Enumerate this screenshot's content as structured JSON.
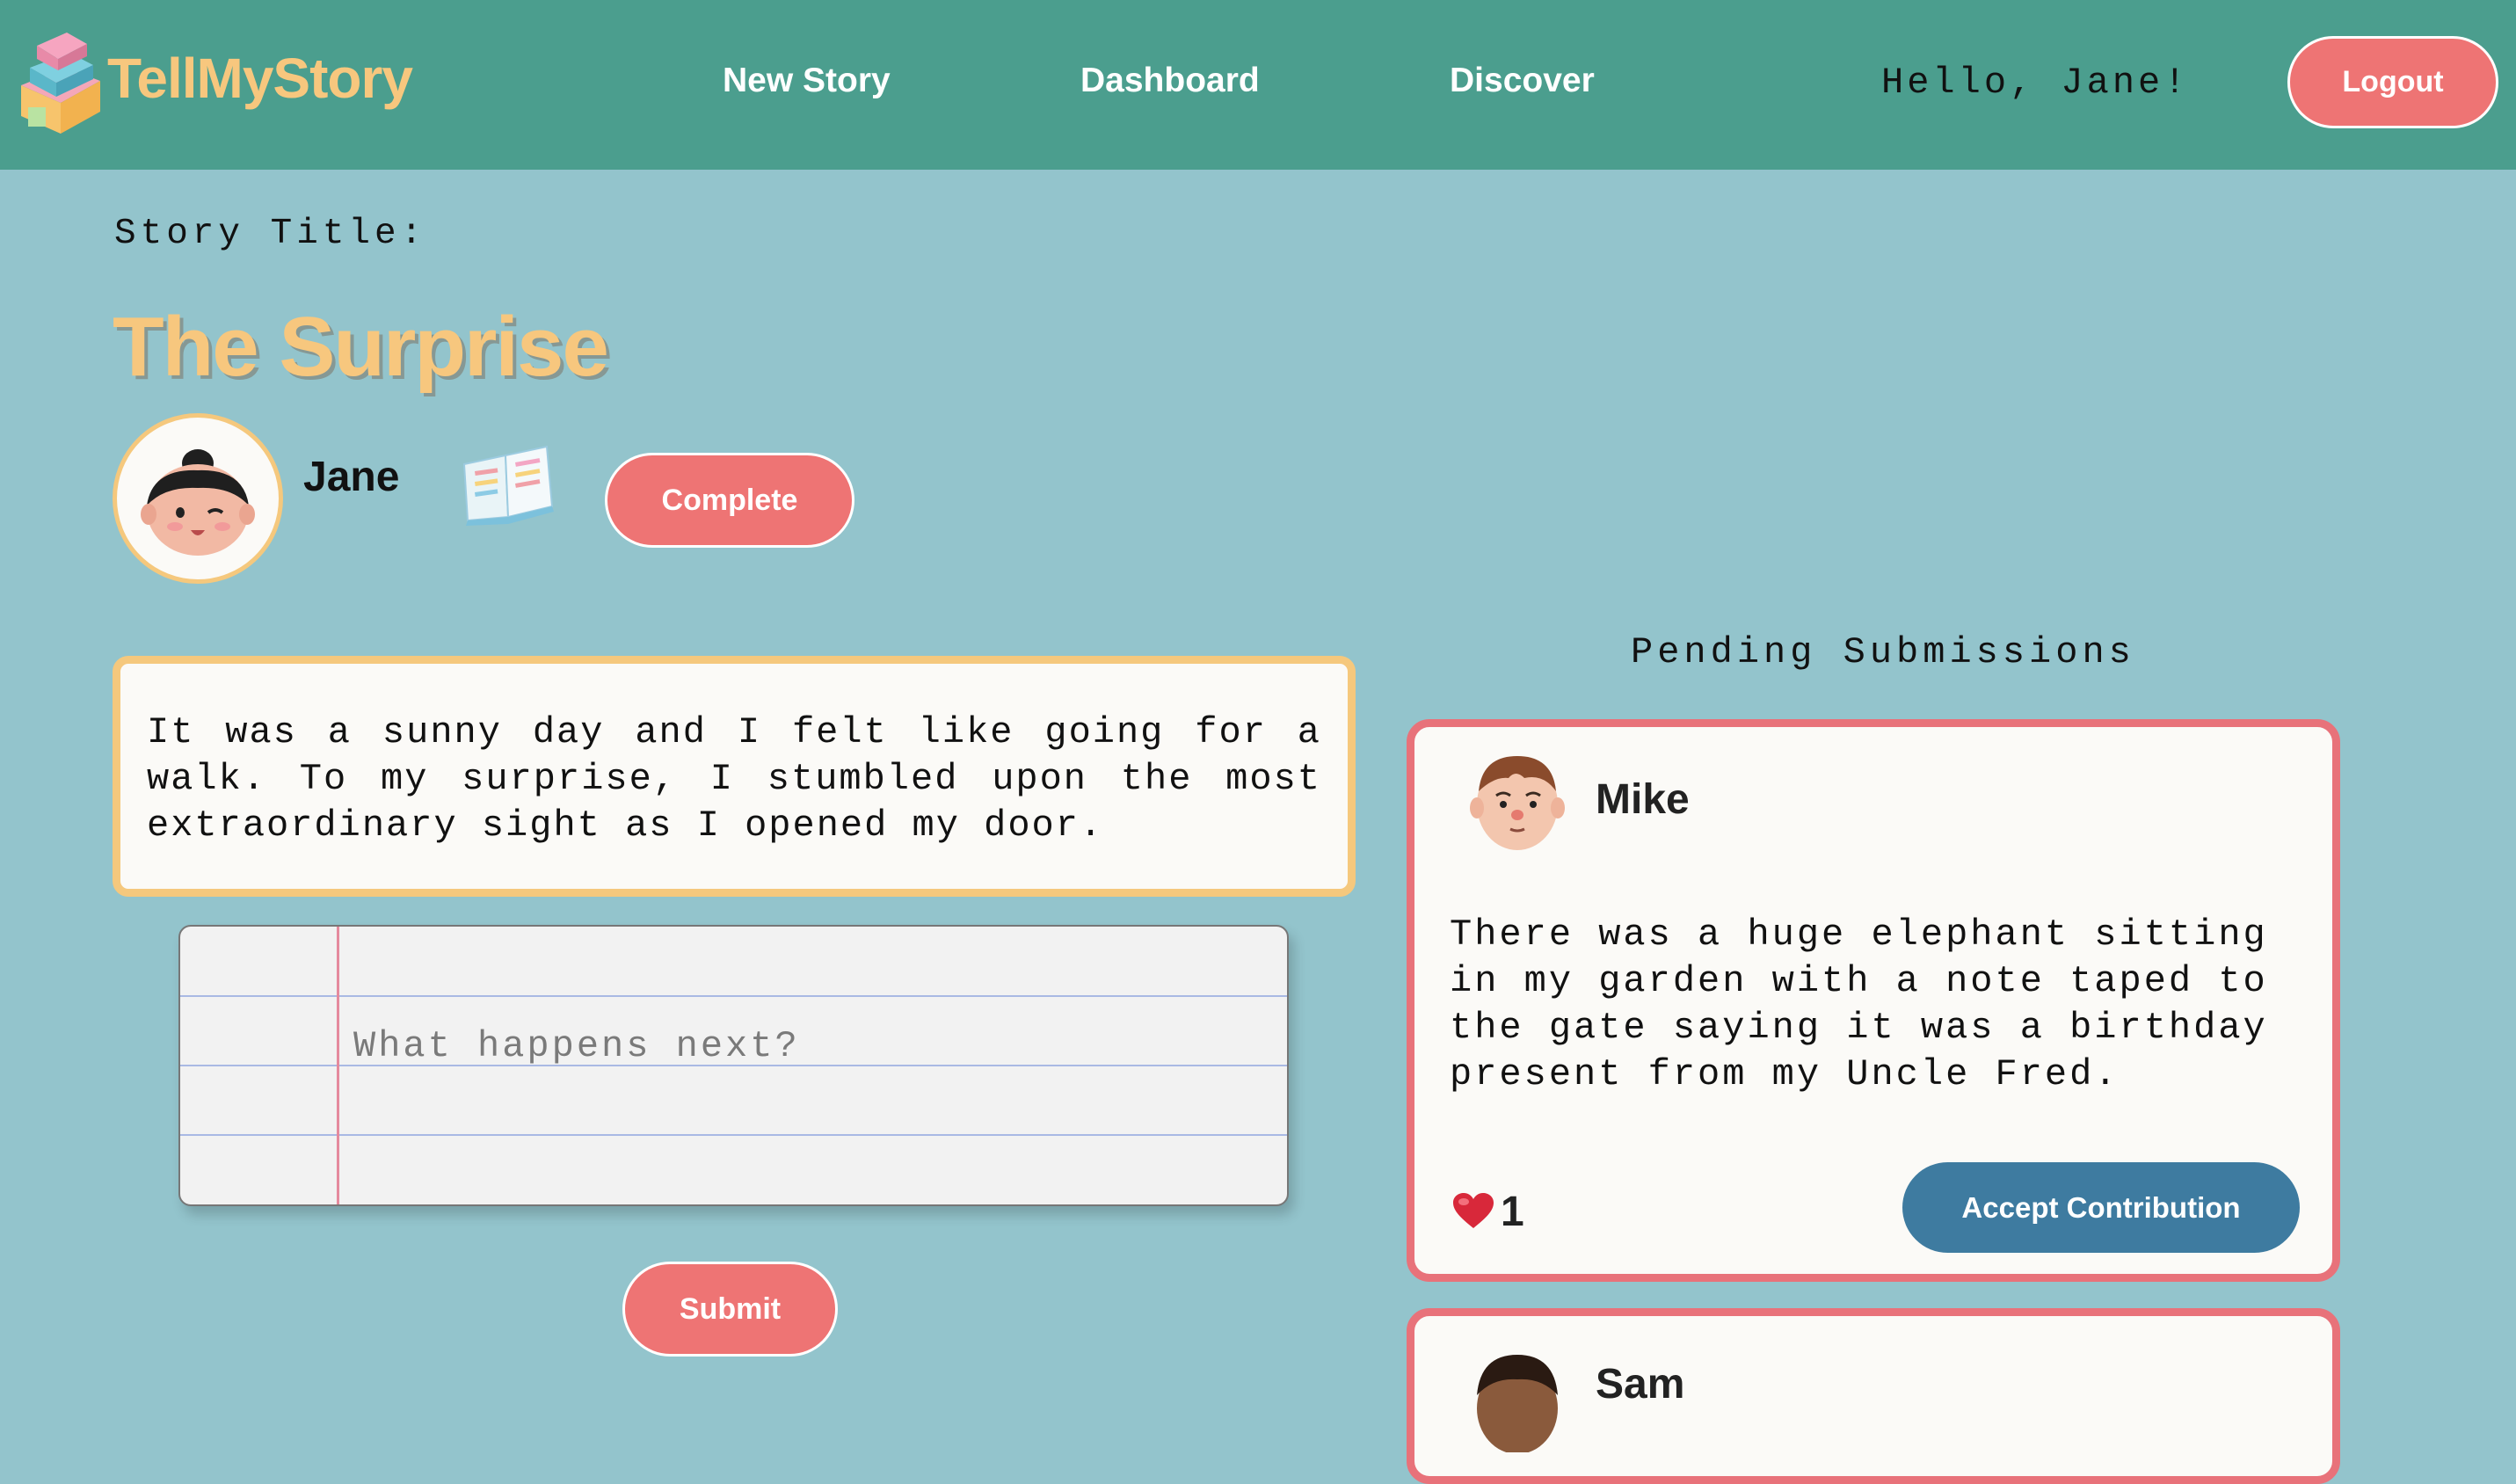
{
  "header": {
    "brand": "TellMyStory",
    "nav": [
      "New Story",
      "Dashboard",
      "Discover"
    ],
    "greeting": "Hello, Jane!",
    "logout_label": "Logout"
  },
  "story": {
    "label": "Story Title:",
    "title": "The Surprise",
    "author": "Jane",
    "complete_label": "Complete",
    "text": "It was a sunny day and I felt like going for a walk. To my surprise, I stumbled upon the most extraordinary sight as I opened my door."
  },
  "contribution": {
    "placeholder": "What happens next?",
    "submit_label": "Submit"
  },
  "pending": {
    "title": "Pending Submissions",
    "submissions": [
      {
        "name": "Mike",
        "text": "There was a huge elephant sitting in my garden with a note taped to the gate saying it was a birthday present from my Uncle Fred.",
        "likes": "1",
        "accept_label": "Accept Contribution"
      },
      {
        "name": "Sam"
      }
    ]
  },
  "colors": {
    "header_bg": "#4b9e8e",
    "page_bg": "#93c4cc",
    "accent_pink": "#ee7474",
    "title_yellow": "#f7c77e",
    "accept_blue": "#3e7ba0"
  }
}
